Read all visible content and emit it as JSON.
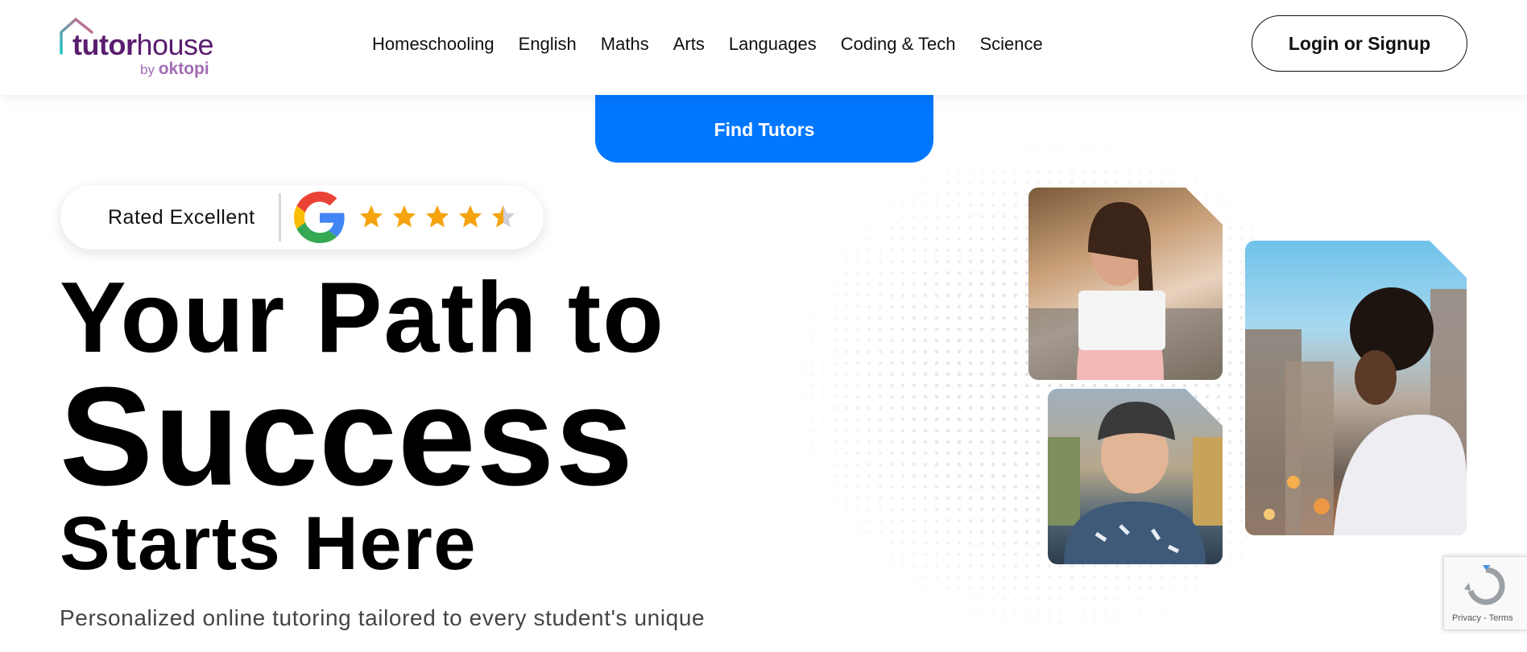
{
  "header": {
    "logo": {
      "word_bold": "tutor",
      "word_light": "house",
      "by": "by",
      "brand": "oktopi"
    },
    "nav": [
      {
        "label": "Homeschooling"
      },
      {
        "label": "English"
      },
      {
        "label": "Maths"
      },
      {
        "label": "Arts"
      },
      {
        "label": "Languages"
      },
      {
        "label": "Coding & Tech"
      },
      {
        "label": "Science"
      }
    ],
    "login_label": "Login or Signup"
  },
  "find_tutors_label": "Find Tutors",
  "rating": {
    "label": "Rated Excellent",
    "stars": 4.5,
    "icon": "google-logo-icon"
  },
  "hero": {
    "line1": "Your Path to",
    "line2": "Success",
    "line3": "Starts Here",
    "subtitle": "Personalized online tutoring tailored to every student's unique"
  },
  "recaptcha": {
    "privacy": "Privacy",
    "sep": " - ",
    "terms": "Terms"
  },
  "colors": {
    "brand_purple": "#5a1d6f",
    "find_blue": "#0077ff",
    "star": "#f5a30f"
  }
}
